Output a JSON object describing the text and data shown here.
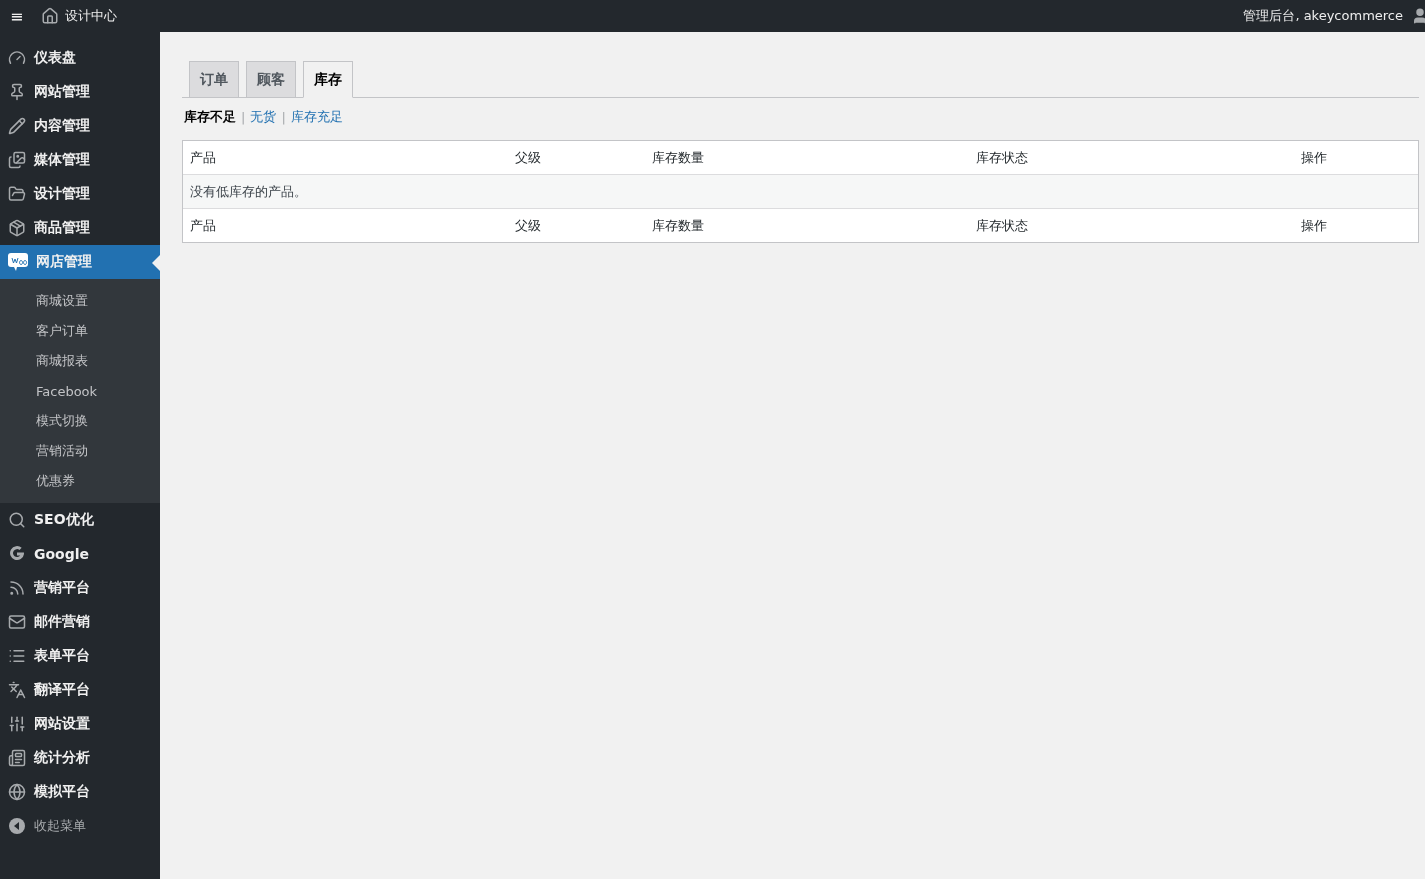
{
  "topbar": {
    "menu_toggle": "≡",
    "site_title": "设计中心",
    "greeting": "管理后台, akeycommerce"
  },
  "sidebar": {
    "items": [
      {
        "label": "仪表盘",
        "selected": false
      },
      {
        "label": "网站管理",
        "selected": false
      },
      {
        "label": "内容管理",
        "selected": false
      },
      {
        "label": "媒体管理",
        "selected": false
      },
      {
        "label": "设计管理",
        "selected": false
      },
      {
        "label": "商品管理",
        "selected": false
      },
      {
        "label": "网店管理",
        "selected": true,
        "children": [
          {
            "label": "商城设置"
          },
          {
            "label": "客户订单"
          },
          {
            "label": "商城报表"
          },
          {
            "label": "Facebook"
          },
          {
            "label": "模式切换"
          },
          {
            "label": "营销活动"
          },
          {
            "label": "优惠券"
          }
        ]
      },
      {
        "label": "SEO优化",
        "selected": false
      },
      {
        "label": "Google",
        "selected": false
      },
      {
        "label": "营销平台",
        "selected": false
      },
      {
        "label": "邮件营销",
        "selected": false
      },
      {
        "label": "表单平台",
        "selected": false
      },
      {
        "label": "翻译平台",
        "selected": false
      },
      {
        "label": "网站设置",
        "selected": false
      },
      {
        "label": "统计分析",
        "selected": false
      },
      {
        "label": "模拟平台",
        "selected": false
      }
    ],
    "collapse": "收起菜单"
  },
  "tabs": [
    {
      "label": "订单",
      "selected": false
    },
    {
      "label": "顾客",
      "selected": false
    },
    {
      "label": "库存",
      "selected": true
    }
  ],
  "filters": [
    {
      "label": "库存不足",
      "selected": true
    },
    {
      "separator": "|",
      "label": "无货",
      "selected": false
    },
    {
      "separator": "|",
      "label": "库存充足",
      "selected": false
    }
  ],
  "table": {
    "columns": [
      "产品",
      "父级",
      "库存数量",
      "库存状态",
      "操作"
    ],
    "empty_message": "没有低库存的产品。",
    "footer_columns": [
      "产品",
      "父级",
      "库存数量",
      "库存状态",
      "操作"
    ]
  }
}
